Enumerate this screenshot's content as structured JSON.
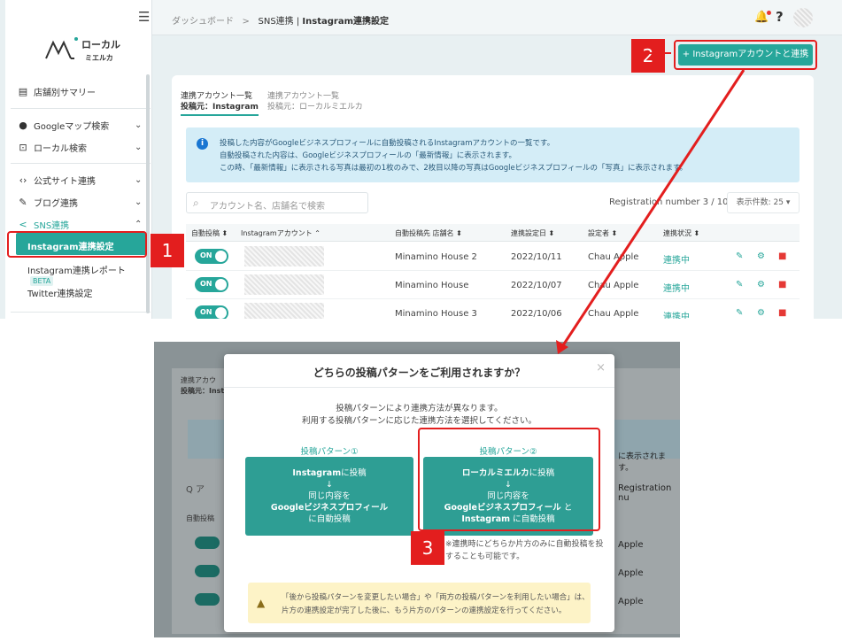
{
  "sidebar": {
    "logo_text_top": "ローカル",
    "logo_text_bottom": "ミエルカ",
    "items": [
      {
        "label": "店舗別サマリー",
        "icon": "store-icon"
      },
      {
        "label": "Googleマップ検索",
        "icon": "map-pin-icon"
      },
      {
        "label": "ローカル検索",
        "icon": "search-box-icon"
      },
      {
        "label": "公式サイト連携",
        "icon": "code-icon"
      },
      {
        "label": "ブログ連携",
        "icon": "pencil-icon"
      },
      {
        "label": "SNS連携",
        "icon": "share-icon"
      }
    ],
    "sns_sub": {
      "active": "Instagram連携設定",
      "report": "Instagram連携レポート",
      "beta": "BETA",
      "twitter": "Twitter連携設定"
    }
  },
  "header": {
    "crumb_dashboard": "ダッシュボード",
    "crumb_sep": ">",
    "crumb_section": "SNS連携",
    "crumb_divider": "|",
    "crumb_page": "Instagram連携設定"
  },
  "toolbar": {
    "add_label": "+ Instagramアカウントと連携"
  },
  "tabs": [
    {
      "title": "連携アカウント一覧",
      "sub": "投稿元：Instagram"
    },
    {
      "title": "連携アカウント一覧",
      "sub": "投稿元：ローカルミエルカ"
    }
  ],
  "info": {
    "lines": [
      "投稿した内容がGoogleビジネスプロフィールに自動投稿されるInstagramアカウントの一覧です。",
      "自動投稿された内容は、Googleビジネスプロフィールの「最新情報」に表示されます。",
      "この時、「最新情報」に表示される写真は最初の1枚のみで、2枚目以降の写真はGoogleビジネスプロフィールの「写真」に表示されます。"
    ]
  },
  "search": {
    "placeholder": "アカウント名、店舗名で検索"
  },
  "registration": "Registration number 3 / 10",
  "per_page": "表示件数: 25 ▾",
  "table": {
    "headers": [
      "自動投稿 ⬍",
      "Instagramアカウント ⌃",
      "自動投稿先 店舗名 ⬍",
      "連携設定日 ⬍",
      "設定者 ⬍",
      "連携状況 ⬍"
    ],
    "rows": [
      {
        "toggle": "ON",
        "store": "Minamino House 2",
        "date": "2022/10/11",
        "by": "Chau Apple",
        "status": "連携中"
      },
      {
        "toggle": "ON",
        "store": "Minamino House",
        "date": "2022/10/07",
        "by": "Chau Apple",
        "status": "連携中"
      },
      {
        "toggle": "ON",
        "store": "Minamino House 3",
        "date": "2022/10/06",
        "by": "Chau Apple",
        "status": "連携中"
      }
    ]
  },
  "markers": {
    "one": "1",
    "two": "2",
    "three": "3"
  },
  "modal": {
    "title": "どちらの投稿パターンをご利用されますか？",
    "close": "×",
    "desc1": "投稿パターンにより連携方法が異なります。",
    "desc2": "利用する投稿パターンに応じた連携方法を選択してください。",
    "p1_label": "投稿パターン①",
    "p1_l1a": "Instagram",
    "p1_l1b": "に投稿",
    "p1_arrow": "↓",
    "p1_l2": "同じ内容を",
    "p1_l3": "Googleビジネスプロフィール",
    "p1_l4": "に自動投稿",
    "p2_label": "投稿パターン②",
    "p2_l1a": "ローカルミエルカ",
    "p2_l1b": "に投稿",
    "p2_arrow": "↓",
    "p2_l2": "同じ内容を",
    "p2_l3a": "Googleビジネスプロフィール",
    "p2_l3b": " と",
    "p2_l4a": "Instagram",
    "p2_l4b": " に自動投稿",
    "note1": "※連携時にどちらか片方のみに自動投稿を投",
    "note2": "することも可能です。",
    "warn1": "「後から投稿パターンを変更したい場合」や「両方の投稿パターンを利用したい場合」は、",
    "warn2": "片方の連携設定が完了した後に、もう片方のパターンの連携設定を行ってください。"
  },
  "bg": {
    "tab": "連携アカウ",
    "tab_sub": "投稿元：Insta",
    "col": "自動投稿",
    "on": "ON",
    "right_text": "に表示されます。",
    "reg": "Registration nu",
    "apple": "Apple",
    "status_abbr": "連",
    "sort_glyph": "⬍",
    "search_glyph": "Q ア"
  }
}
